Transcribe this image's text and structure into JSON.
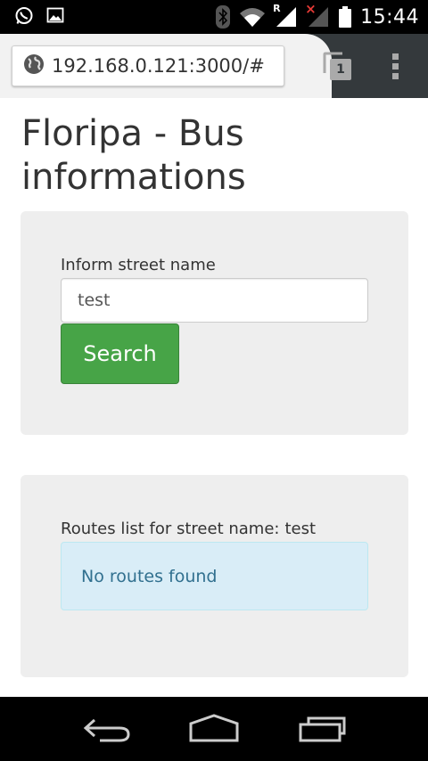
{
  "status_bar": {
    "time": "15:44",
    "left_icons": [
      "whatsapp-icon",
      "image-icon"
    ],
    "right_icons": [
      "bluetooth-icon",
      "wifi-icon",
      "signal-roaming-icon",
      "signal-no-sim-icon",
      "battery-icon"
    ],
    "roaming_letter": "R",
    "no_sim_mark": "×"
  },
  "browser": {
    "url": "192.168.0.121:3000/#",
    "tab_count": "1",
    "toolbar_color": "#34393c"
  },
  "page": {
    "title": "Floripa - Bus informations",
    "search": {
      "label": "Inform street name",
      "value": "test",
      "button_label": "Search",
      "button_color": "#47a447"
    },
    "results": {
      "label_prefix": "Routes list for street name:",
      "street_name": "test",
      "message": "No routes found",
      "alert_color": "#d9edf7"
    }
  },
  "nav_bar": {
    "buttons": [
      "back-icon",
      "home-icon",
      "recent-apps-icon"
    ]
  }
}
